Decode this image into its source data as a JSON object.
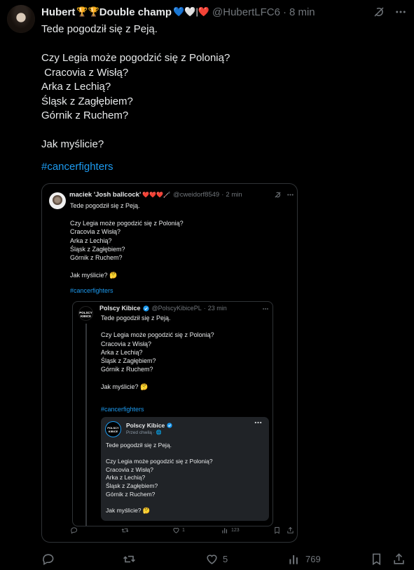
{
  "tweet": {
    "display_name": "Hubert",
    "name_emojis": "🏆🏆",
    "name_suffix": "Double champ",
    "name_hearts": "💙🤍|❤️",
    "handle": "@HubertLFC6",
    "separator": "·",
    "time": "8 min",
    "text": "Tede pogodził się z Peją.\n\nCzy Legia może pogodzić się z Polonią?\n Cracovia z Wisłą?\nArka z Lechią?\nŚląsk z Zagłębiem?\nGórnik z Ruchem?\n\nJak myślicie?",
    "hashtag": "#cancerfighters",
    "actions": {
      "reply": "",
      "retweet": "",
      "likes": "5",
      "views": "769",
      "bookmark": "",
      "share": ""
    }
  },
  "quote": {
    "display_name": "maciek 'Josh ballcock'",
    "name_emojis": "❤️❤️❤️🦯",
    "handle": "@cweidorf8549",
    "separator": "·",
    "time": "2 min",
    "text": "Tede pogodził się z Peją.\n\nCzy Legia może pogodzić się z Polonią?\nCracovia z Wisłą?\nArka z Lechią?\nŚląsk z Zagłębiem?\nGórnik z Ruchem?\n\nJak myślicie? 🤔",
    "hashtag": "#cancerfighters",
    "actions": {
      "reply": "",
      "retweet": "",
      "likes": "1",
      "views": "123",
      "bookmark": "",
      "share": ""
    },
    "inner": {
      "avatar_text": "POLSCY KIBICE",
      "display_name": "Polscy Kibice",
      "handle": "@PolscyKibicePL",
      "separator": "·",
      "time": "23 min",
      "text": "Tede pogodził się z Peją.\n\nCzy Legia może pogodzić się z Polonią?\nCracovia z Wisłą?\nArka z Lechią?\nŚląsk z Zagłębiem?\nGórnik z Ruchem?\n\nJak myślicie? 🤔",
      "hashtag": "#cancerfighters",
      "card": {
        "avatar_text": "POLSCY KIBICE",
        "display_name": "Polscy Kibice",
        "subtitle": "Przed chwilą · 🌐",
        "text": "Tede pogodził się z Peją.\n\nCzy Legia może pogodzić się z Polonią?\nCracovia z Wisłą?\nArka z Lechią?\nŚląsk z Zagłębiem?\nGórnik z Ruchem?\n\nJak myślicie? 🤔"
      }
    }
  },
  "colors": {
    "background": "#000000",
    "text": "#e7e9ea",
    "muted": "#71767b",
    "link": "#1d9bf0",
    "border": "#2f3336",
    "card": "#202327"
  },
  "icons": [
    "grok-icon",
    "more-icon",
    "verified-icon",
    "reply-icon",
    "retweet-icon",
    "like-icon",
    "views-icon",
    "bookmark-icon",
    "share-icon"
  ]
}
